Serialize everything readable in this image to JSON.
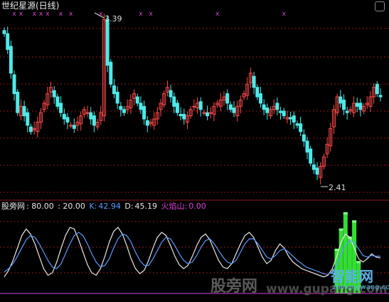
{
  "title": "世纪星源(日线)",
  "indicator": {
    "name": "股旁网",
    "p1": ": 80.00",
    "p2": ": 20.00",
    "k_label": "K:",
    "k_value": "42.94",
    "d_label": "D:",
    "d_value": "45.19",
    "fire_label": "火焰山:",
    "fire_value": "0.00"
  },
  "watermark": {
    "cn": "股旁网",
    "url": "www.gupang.com",
    "logo": "智能网",
    "logo_url": "zhinengwang.com"
  },
  "colors": {
    "up": "#ff4a4a",
    "down": "#4ee8e8",
    "k_line": "#e8e8e8",
    "d_line": "#5c9cff",
    "fire": "#33dd33",
    "fire_top": "#88ff88",
    "marker": "#dd44dd",
    "grid": "#8b1a1a"
  },
  "chart_data": [
    {
      "type": "candlestick",
      "title": "世纪星源(日线)",
      "price_max": 3.39,
      "price_min": 2.41,
      "max_label": "3.39",
      "min_label": "2.41",
      "ylim": [
        2.35,
        3.45
      ],
      "close_series": [
        3.3,
        3.2,
        3.05,
        2.92,
        2.8,
        2.84,
        2.78,
        2.72,
        2.68,
        2.7,
        2.74,
        2.8,
        2.86,
        2.92,
        2.96,
        2.9,
        2.84,
        2.8,
        2.76,
        2.74,
        2.72,
        2.7,
        2.74,
        2.78,
        2.82,
        2.8,
        2.76,
        2.72,
        2.74,
        2.8,
        3.39,
        3.1,
        2.98,
        2.92,
        2.86,
        2.82,
        2.8,
        2.84,
        2.88,
        2.92,
        2.86,
        2.82,
        2.76,
        2.72,
        2.74,
        2.76,
        2.8,
        2.86,
        2.92,
        2.96,
        2.9,
        2.84,
        2.8,
        2.78,
        2.76,
        2.78,
        2.82,
        2.84,
        2.86,
        2.82,
        2.8,
        2.78,
        2.8,
        2.84,
        2.86,
        2.88,
        2.9,
        2.86,
        2.82,
        2.8,
        2.84,
        2.88,
        2.92,
        2.98,
        3.05,
        2.96,
        2.9,
        2.86,
        2.82,
        2.8,
        2.82,
        2.84,
        2.82,
        2.8,
        2.78,
        2.77,
        2.76,
        2.74,
        2.72,
        2.68,
        2.62,
        2.55,
        2.48,
        2.44,
        2.41,
        2.46,
        2.52,
        2.6,
        2.7,
        2.82,
        2.9,
        2.86,
        2.82,
        2.8,
        2.82,
        2.86,
        2.84,
        2.82,
        2.84,
        2.86,
        2.9,
        2.96,
        2.92,
        2.9
      ],
      "markers_top": [
        "x",
        "x",
        "x",
        "x",
        "x",
        "x",
        "x",
        "x",
        "x",
        "x",
        "x",
        "x"
      ]
    },
    {
      "type": "line",
      "title": "股旁网",
      "levels": [
        80,
        20
      ],
      "series": [
        {
          "name": "K",
          "last": 42.94,
          "values": [
            20,
            28,
            40,
            55,
            70,
            78,
            72,
            60,
            45,
            30,
            22,
            25,
            38,
            55,
            70,
            80,
            78,
            65,
            50,
            35,
            25,
            22,
            30,
            45,
            62,
            75,
            80,
            72,
            58,
            42,
            30,
            24,
            28,
            40,
            55,
            68,
            74,
            70,
            58,
            45,
            35,
            30,
            34,
            45,
            58,
            68,
            72,
            65,
            52,
            40,
            32,
            30,
            36,
            48,
            60,
            70,
            74,
            68,
            56,
            44,
            36,
            40,
            52,
            60,
            55,
            45,
            38,
            34,
            30,
            28,
            26,
            24,
            22,
            20,
            22,
            30,
            45,
            62,
            72,
            68,
            55,
            42,
            38,
            42,
            48,
            44,
            42.94
          ]
        },
        {
          "name": "D",
          "last": 45.19,
          "values": [
            26,
            30,
            36,
            45,
            55,
            65,
            70,
            68,
            60,
            50,
            40,
            32,
            30,
            36,
            48,
            60,
            70,
            74,
            70,
            60,
            48,
            38,
            32,
            34,
            42,
            55,
            66,
            72,
            70,
            62,
            50,
            40,
            34,
            34,
            42,
            52,
            62,
            68,
            66,
            58,
            48,
            40,
            36,
            38,
            46,
            56,
            64,
            66,
            60,
            52,
            44,
            38,
            36,
            40,
            50,
            60,
            66,
            66,
            60,
            52,
            44,
            42,
            46,
            52,
            54,
            50,
            45,
            40,
            36,
            32,
            30,
            28,
            26,
            24,
            23,
            26,
            34,
            46,
            58,
            64,
            62,
            54,
            46,
            44,
            46,
            45,
            45.19
          ]
        },
        {
          "name": "火焰山",
          "last": 0.0,
          "bars": [
            0,
            0,
            0,
            0,
            0,
            0,
            0,
            0,
            0,
            0,
            0,
            0,
            0,
            0,
            0,
            0,
            0,
            0,
            0,
            0,
            0,
            0,
            0,
            0,
            0,
            0,
            0,
            0,
            0,
            0,
            0,
            0,
            0,
            0,
            0,
            0,
            0,
            0,
            0,
            0,
            0,
            0,
            0,
            0,
            0,
            0,
            0,
            0,
            0,
            0,
            0,
            0,
            0,
            0,
            0,
            0,
            0,
            0,
            0,
            0,
            0,
            0,
            0,
            0,
            0,
            0,
            0,
            0,
            0,
            0,
            0,
            0,
            0,
            0,
            0,
            0,
            55,
            80,
            100,
            70,
            90,
            40,
            0,
            0,
            0,
            0,
            0
          ]
        }
      ]
    }
  ]
}
